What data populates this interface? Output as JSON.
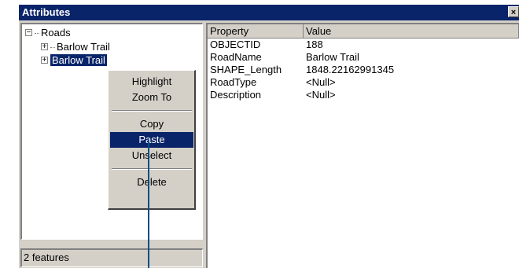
{
  "window": {
    "title": "Attributes",
    "close_glyph": "×"
  },
  "tree": {
    "root": {
      "label": "Roads",
      "toggle": "−"
    },
    "items": [
      {
        "label": "Barlow Trail",
        "toggle": "+"
      },
      {
        "label": "Barlow Trail",
        "toggle": "+",
        "selected": true
      }
    ]
  },
  "status": {
    "text": "2 features"
  },
  "grid": {
    "columns": [
      "Property",
      "Value"
    ],
    "rows": [
      {
        "property": "OBJECTID",
        "value": "188"
      },
      {
        "property": "RoadName",
        "value": "Barlow Trail"
      },
      {
        "property": "SHAPE_Length",
        "value": "1848.22162991345"
      },
      {
        "property": "RoadType",
        "value": "<Null>"
      },
      {
        "property": "Description",
        "value": "<Null>"
      }
    ]
  },
  "context_menu": {
    "items": [
      "Highlight",
      "Zoom To",
      "Copy",
      "Paste",
      "Unselect",
      "Delete"
    ],
    "highlighted": "Paste"
  },
  "colors": {
    "selection": "#0a246a",
    "leader_line": "#0a4c84",
    "face": "#d4d0c8"
  }
}
